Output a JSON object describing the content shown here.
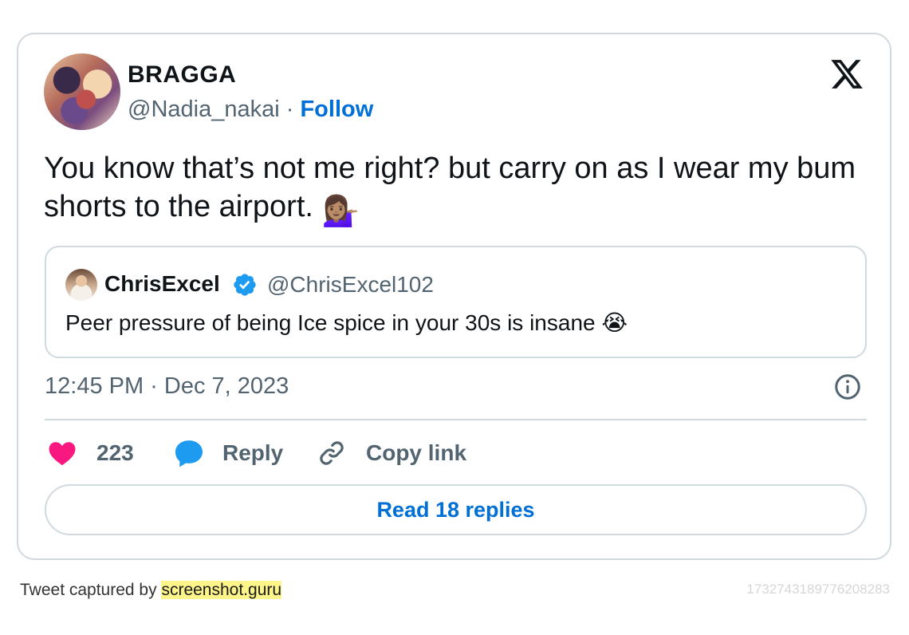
{
  "author": {
    "display_name": "BRAGGA",
    "handle": "@Nadia_nakai",
    "separator": "·",
    "follow_label": "Follow"
  },
  "tweet": {
    "text": "You know that’s not me right? but carry on as I wear my bum shorts to the airport.",
    "emoji": "💁🏽‍♀️",
    "timestamp": "12:45 PM · Dec 7, 2023"
  },
  "quoted_tweet": {
    "display_name": "ChrisExcel",
    "handle": "@ChrisExcel102",
    "text": "Peer pressure of being Ice spice in your 30s is insane",
    "emoji": "😭",
    "verified": true
  },
  "actions": {
    "likes_count": "223",
    "reply_label": "Reply",
    "copy_link_label": "Copy link",
    "read_replies_label": "Read 18 replies"
  },
  "footer": {
    "captured_by_text": "Tweet captured by",
    "brand": "screenshot.guru",
    "tweet_id": "1732743189776208283"
  },
  "colors": {
    "accent": "#006fd6",
    "like": "#f91880",
    "reply_bubble": "#1d9bf0",
    "verified": "#1d9bf0",
    "muted_text": "#536471",
    "border": "#cfd9de",
    "brand_highlight": "#fdf58a"
  },
  "icons": {
    "logo": "x-logo-icon",
    "verified": "verified-badge-icon",
    "info": "info-icon",
    "like": "heart-icon",
    "reply": "speech-bubble-icon",
    "copy_link": "link-icon"
  }
}
